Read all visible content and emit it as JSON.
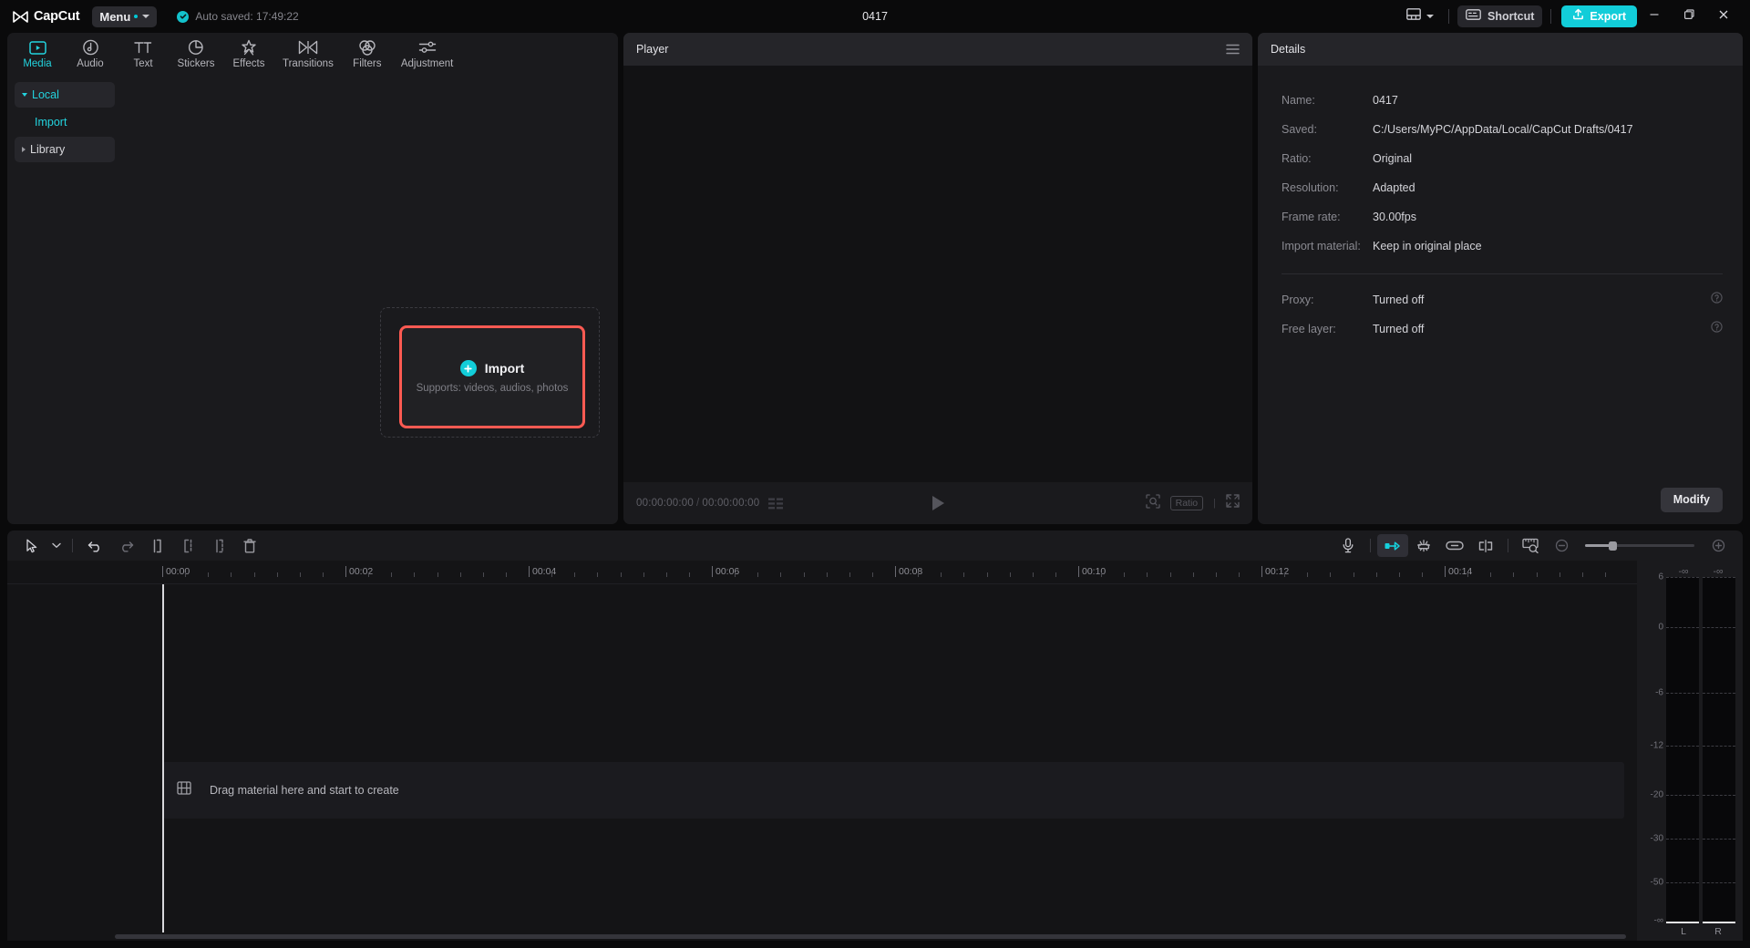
{
  "titlebar": {
    "brand": "CapCut",
    "menu_label": "Menu",
    "autosave_text": "Auto saved: 17:49:22",
    "window_title": "0417",
    "shortcut_label": "Shortcut",
    "export_label": "Export",
    "icons": {
      "brand": "capcut-logo-icon",
      "check": "check-circle-icon",
      "layout": "layout-icon",
      "caret": "chevron-down-icon",
      "keyboard": "keyboard-icon",
      "upload": "upload-icon",
      "minimize": "minimize-icon",
      "maximize": "maximize-icon",
      "close": "close-icon"
    }
  },
  "tabs": [
    {
      "label": "Media",
      "icon": "media-icon",
      "active": true
    },
    {
      "label": "Audio",
      "icon": "audio-icon",
      "active": false
    },
    {
      "label": "Text",
      "icon": "text-icon",
      "active": false
    },
    {
      "label": "Stickers",
      "icon": "stickers-icon",
      "active": false
    },
    {
      "label": "Effects",
      "icon": "effects-icon",
      "active": false
    },
    {
      "label": "Transitions",
      "icon": "transitions-icon",
      "active": false
    },
    {
      "label": "Filters",
      "icon": "filters-icon",
      "active": false
    },
    {
      "label": "Adjustment",
      "icon": "adjustment-icon",
      "active": false
    }
  ],
  "sidebar": {
    "items": [
      {
        "label": "Local",
        "selected": true,
        "expanded": true
      },
      {
        "label": "Import",
        "sub": true
      },
      {
        "label": "Library",
        "selected": false,
        "expanded": false
      }
    ]
  },
  "import": {
    "title": "Import",
    "subtitle": "Supports: videos, audios, photos",
    "highlight_color": "#ff5a52",
    "accent_color": "#12cdd9"
  },
  "player": {
    "title": "Player",
    "current_time": "00:00:00:00",
    "total_time": "00:00:00:00",
    "separator": "/",
    "ratio_badge": "Ratio",
    "icons": {
      "menu": "hamburger-menu-icon",
      "frames": "frames-icon",
      "play": "play-icon",
      "snapshot": "snapshot-icon",
      "fullscreen": "fullscreen-icon"
    }
  },
  "details": {
    "title": "Details",
    "rows": [
      {
        "label": "Name:",
        "value": "0417"
      },
      {
        "label": "Saved:",
        "value": "C:/Users/MyPC/AppData/Local/CapCut Drafts/0417"
      },
      {
        "label": "Ratio:",
        "value": "Original"
      },
      {
        "label": "Resolution:",
        "value": "Adapted"
      },
      {
        "label": "Frame rate:",
        "value": "30.00fps"
      },
      {
        "label": "Import material:",
        "value": "Keep in original place"
      }
    ],
    "rows2": [
      {
        "label": "Proxy:",
        "value": "Turned off",
        "help": true
      },
      {
        "label": "Free layer:",
        "value": "Turned off",
        "help": true
      }
    ],
    "modify_label": "Modify"
  },
  "timeline": {
    "tools_left": [
      {
        "name": "select-cursor-icon"
      },
      {
        "name": "chevron-down-icon"
      },
      {
        "name": "undo-icon"
      },
      {
        "name": "redo-icon"
      },
      {
        "name": "trim-start-icon"
      },
      {
        "name": "trim-end-icon"
      },
      {
        "name": "split-icon"
      },
      {
        "name": "delete-icon"
      }
    ],
    "tools_right": [
      {
        "name": "microphone-icon"
      },
      {
        "name": "snap-toggle-icon",
        "active": true
      },
      {
        "name": "magnet-icon"
      },
      {
        "name": "link-icon"
      },
      {
        "name": "split-clip-icon"
      },
      {
        "name": "ruler-zoom-icon"
      },
      {
        "name": "zoom-out-icon"
      },
      {
        "name": "zoom-slider"
      },
      {
        "name": "zoom-in-icon"
      }
    ],
    "ruler_labels": [
      "00:00",
      "00:02",
      "00:04",
      "00:06",
      "00:08",
      "00:10",
      "00:12",
      "00:14"
    ],
    "drop_text": "Drag material here and start to create",
    "drop_icon": "film-strip-icon"
  },
  "audio_meter": {
    "left_top": "-∞",
    "right_top": "-∞",
    "scale": [
      "6",
      "0",
      "-6",
      "-12",
      "-20",
      "-30",
      "-50",
      "-∞"
    ],
    "channel_left": "L",
    "channel_right": "R"
  }
}
